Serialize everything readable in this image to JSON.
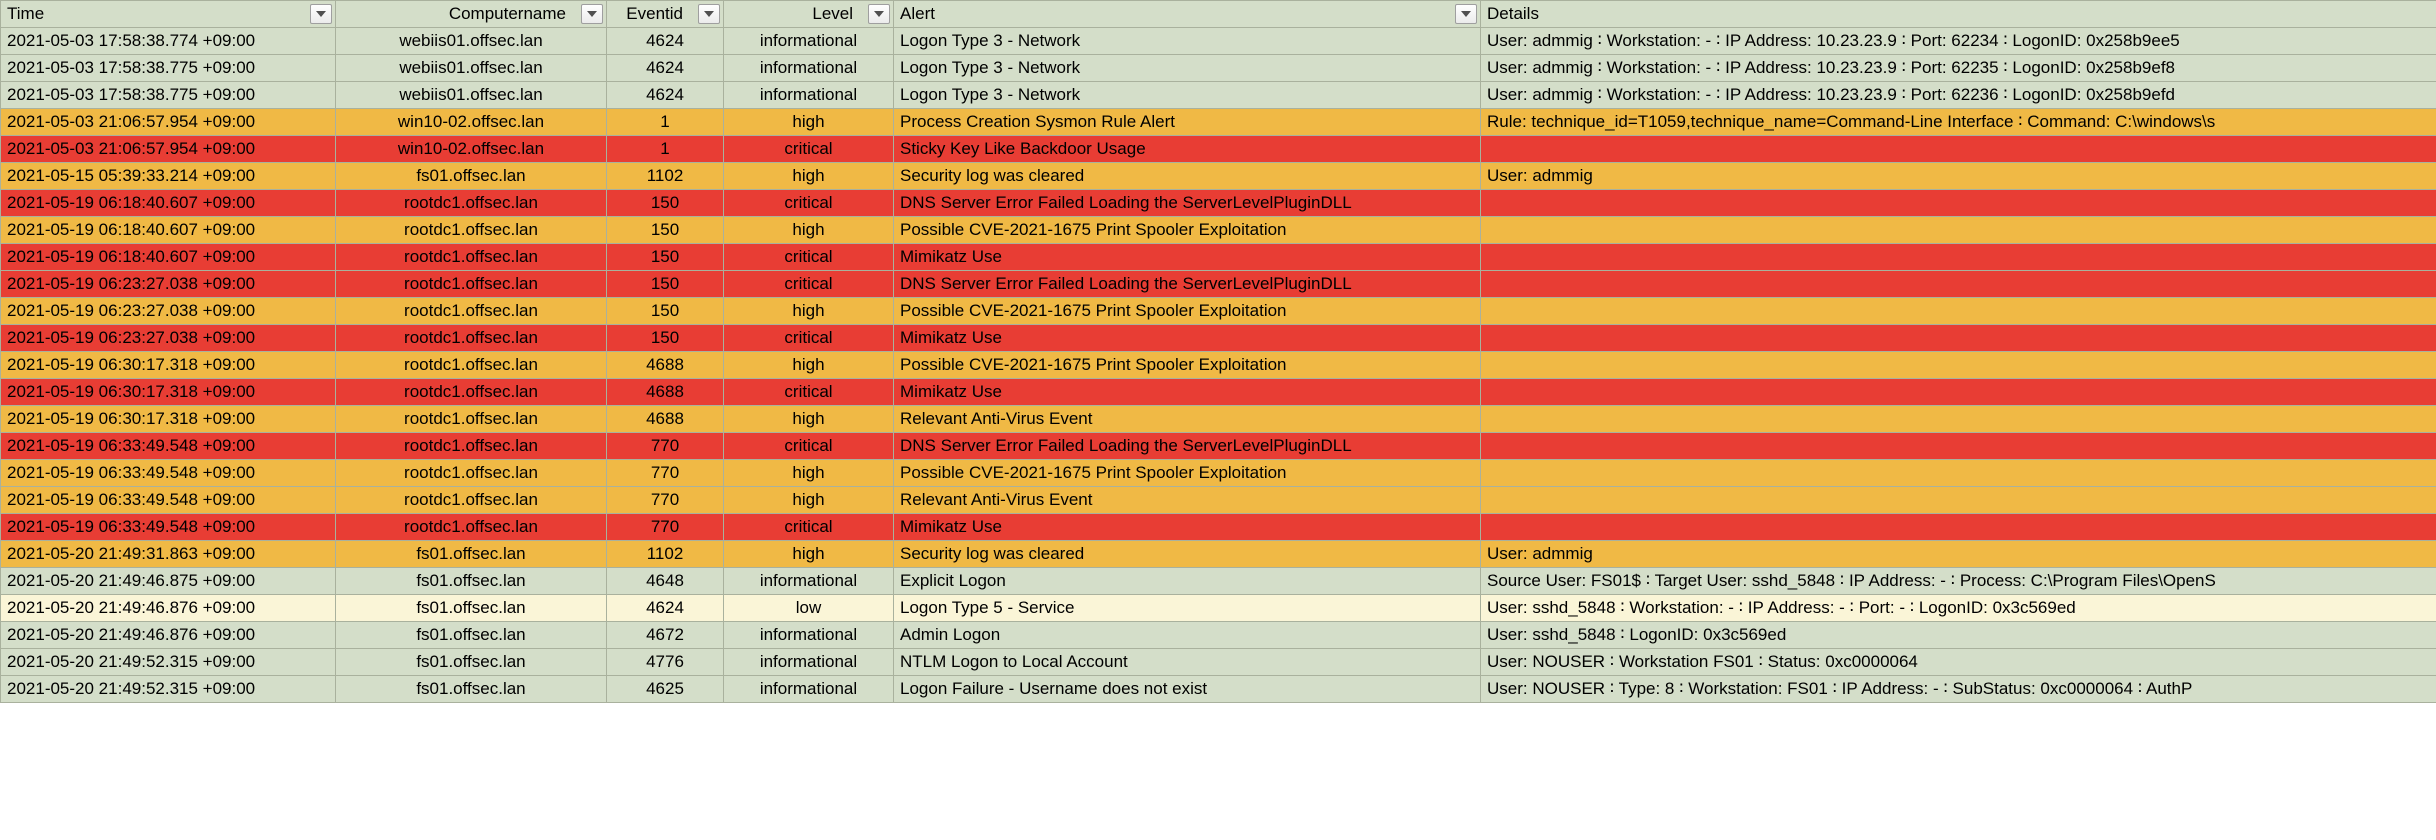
{
  "columns": {
    "time": "Time",
    "comp": "Computername",
    "eventid": "Eventid",
    "level": "Level",
    "alert": "Alert",
    "details": "Details"
  },
  "rows": [
    {
      "time": "2021-05-03 17:58:38.774 +09:00",
      "comp": "webiis01.offsec.lan",
      "eventid": "4624",
      "level": "informational",
      "alert": "Logon Type 3 - Network",
      "details": "User: admmig  ∶  Workstation: -  ∶  IP Address: 10.23.23.9  ∶  Port: 62234  ∶  LogonID: 0x258b9ee5"
    },
    {
      "time": "2021-05-03 17:58:38.775 +09:00",
      "comp": "webiis01.offsec.lan",
      "eventid": "4624",
      "level": "informational",
      "alert": "Logon Type 3 - Network",
      "details": "User: admmig  ∶  Workstation: -  ∶  IP Address: 10.23.23.9  ∶  Port: 62235  ∶  LogonID: 0x258b9ef8"
    },
    {
      "time": "2021-05-03 17:58:38.775 +09:00",
      "comp": "webiis01.offsec.lan",
      "eventid": "4624",
      "level": "informational",
      "alert": "Logon Type 3 - Network",
      "details": "User: admmig  ∶  Workstation: -  ∶  IP Address: 10.23.23.9  ∶  Port: 62236  ∶  LogonID: 0x258b9efd"
    },
    {
      "time": "2021-05-03 21:06:57.954 +09:00",
      "comp": "win10-02.offsec.lan",
      "eventid": "1",
      "level": "high",
      "alert": "Process Creation Sysmon Rule Alert",
      "details": "Rule: technique_id=T1059,technique_name=Command-Line Interface  ∶  Command: C:\\windows\\s"
    },
    {
      "time": "2021-05-03 21:06:57.954 +09:00",
      "comp": "win10-02.offsec.lan",
      "eventid": "1",
      "level": "critical",
      "alert": "Sticky Key Like Backdoor Usage",
      "details": ""
    },
    {
      "time": "2021-05-15 05:39:33.214 +09:00",
      "comp": "fs01.offsec.lan",
      "eventid": "1102",
      "level": "high",
      "alert": "Security log was cleared",
      "details": "User: admmig"
    },
    {
      "time": "2021-05-19 06:18:40.607 +09:00",
      "comp": "rootdc1.offsec.lan",
      "eventid": "150",
      "level": "critical",
      "alert": "DNS Server Error Failed Loading the ServerLevelPluginDLL",
      "details": ""
    },
    {
      "time": "2021-05-19 06:18:40.607 +09:00",
      "comp": "rootdc1.offsec.lan",
      "eventid": "150",
      "level": "high",
      "alert": "Possible CVE-2021-1675 Print Spooler Exploitation",
      "details": ""
    },
    {
      "time": "2021-05-19 06:18:40.607 +09:00",
      "comp": "rootdc1.offsec.lan",
      "eventid": "150",
      "level": "critical",
      "alert": "Mimikatz Use",
      "details": ""
    },
    {
      "time": "2021-05-19 06:23:27.038 +09:00",
      "comp": "rootdc1.offsec.lan",
      "eventid": "150",
      "level": "critical",
      "alert": "DNS Server Error Failed Loading the ServerLevelPluginDLL",
      "details": ""
    },
    {
      "time": "2021-05-19 06:23:27.038 +09:00",
      "comp": "rootdc1.offsec.lan",
      "eventid": "150",
      "level": "high",
      "alert": "Possible CVE-2021-1675 Print Spooler Exploitation",
      "details": ""
    },
    {
      "time": "2021-05-19 06:23:27.038 +09:00",
      "comp": "rootdc1.offsec.lan",
      "eventid": "150",
      "level": "critical",
      "alert": "Mimikatz Use",
      "details": ""
    },
    {
      "time": "2021-05-19 06:30:17.318 +09:00",
      "comp": "rootdc1.offsec.lan",
      "eventid": "4688",
      "level": "high",
      "alert": "Possible CVE-2021-1675 Print Spooler Exploitation",
      "details": ""
    },
    {
      "time": "2021-05-19 06:30:17.318 +09:00",
      "comp": "rootdc1.offsec.lan",
      "eventid": "4688",
      "level": "critical",
      "alert": "Mimikatz Use",
      "details": ""
    },
    {
      "time": "2021-05-19 06:30:17.318 +09:00",
      "comp": "rootdc1.offsec.lan",
      "eventid": "4688",
      "level": "high",
      "alert": "Relevant Anti-Virus Event",
      "details": ""
    },
    {
      "time": "2021-05-19 06:33:49.548 +09:00",
      "comp": "rootdc1.offsec.lan",
      "eventid": "770",
      "level": "critical",
      "alert": "DNS Server Error Failed Loading the ServerLevelPluginDLL",
      "details": ""
    },
    {
      "time": "2021-05-19 06:33:49.548 +09:00",
      "comp": "rootdc1.offsec.lan",
      "eventid": "770",
      "level": "high",
      "alert": "Possible CVE-2021-1675 Print Spooler Exploitation",
      "details": ""
    },
    {
      "time": "2021-05-19 06:33:49.548 +09:00",
      "comp": "rootdc1.offsec.lan",
      "eventid": "770",
      "level": "high",
      "alert": "Relevant Anti-Virus Event",
      "details": ""
    },
    {
      "time": "2021-05-19 06:33:49.548 +09:00",
      "comp": "rootdc1.offsec.lan",
      "eventid": "770",
      "level": "critical",
      "alert": "Mimikatz Use",
      "details": ""
    },
    {
      "time": "2021-05-20 21:49:31.863 +09:00",
      "comp": "fs01.offsec.lan",
      "eventid": "1102",
      "level": "high",
      "alert": "Security log was cleared",
      "details": "User: admmig"
    },
    {
      "time": "2021-05-20 21:49:46.875 +09:00",
      "comp": "fs01.offsec.lan",
      "eventid": "4648",
      "level": "informational",
      "alert": "Explicit Logon",
      "details": "Source User: FS01$  ∶  Target User: sshd_5848  ∶  IP Address: -  ∶  Process: C:\\Program Files\\OpenS"
    },
    {
      "time": "2021-05-20 21:49:46.876 +09:00",
      "comp": "fs01.offsec.lan",
      "eventid": "4624",
      "level": "low",
      "alert": "Logon Type 5 - Service",
      "details": "User: sshd_5848  ∶  Workstation: -  ∶  IP Address: -  ∶  Port: -  ∶  LogonID: 0x3c569ed"
    },
    {
      "time": "2021-05-20 21:49:46.876 +09:00",
      "comp": "fs01.offsec.lan",
      "eventid": "4672",
      "level": "informational",
      "alert": "Admin Logon",
      "details": "User: sshd_5848  ∶  LogonID: 0x3c569ed"
    },
    {
      "time": "2021-05-20 21:49:52.315 +09:00",
      "comp": "fs01.offsec.lan",
      "eventid": "4776",
      "level": "informational",
      "alert": "NTLM Logon to Local Account",
      "details": "User: NOUSER  ∶  Workstation FS01  ∶  Status: 0xc0000064"
    },
    {
      "time": "2021-05-20 21:49:52.315 +09:00",
      "comp": "fs01.offsec.lan",
      "eventid": "4625",
      "level": "informational",
      "alert": "Logon Failure - Username does not exist",
      "details": "User: NOUSER  ∶  Type: 8  ∶  Workstation: FS01  ∶  IP Address: -  ∶  SubStatus: 0xc0000064  ∶  AuthP"
    }
  ]
}
